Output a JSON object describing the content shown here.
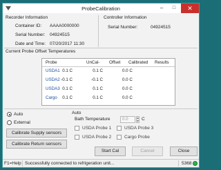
{
  "window": {
    "title": "ProbeCalibration"
  },
  "recorder": {
    "group_title": "Recorder Information",
    "container_label": "Container ID:",
    "container_value": "AAAA0000000",
    "serial_label": "Serial Number:",
    "serial_value": "04924515",
    "datetime_label": "Date and Time:",
    "datetime_value": "07/20/2017 11:30"
  },
  "controller": {
    "group_title": "Controller Information",
    "serial_label": "Serial Number:",
    "serial_value": "04924515"
  },
  "offsets": {
    "group_title": "Current Probe Offset Temperatures",
    "columns": [
      "Probe",
      "UnCal-",
      "Offset",
      "Calibrated",
      "Results"
    ],
    "rows": [
      {
        "probe": "USDA1",
        "uncal": "0.1 C",
        "offset": "0.1 C",
        "calibrated": "0.0 C",
        "result": ""
      },
      {
        "probe": "USDA2",
        "uncal": "-0.1 C",
        "offset": "-0.1 C",
        "calibrated": "0.0 C",
        "result": ""
      },
      {
        "probe": "USDA3",
        "uncal": "0.1 C",
        "offset": "0.1 C",
        "calibrated": "0.0 C",
        "result": ""
      },
      {
        "probe": "Cargo",
        "uncal": "0.1 C",
        "offset": "0.1 C",
        "calibrated": "0.0 C",
        "result": ""
      }
    ]
  },
  "mode": {
    "auto_label": "Auto",
    "external_label": "External",
    "selected": "Auto",
    "calibrate_supply": "Calibrate Supply sensors",
    "calibrate_return": "Calibrate Return sensors"
  },
  "auto_panel": {
    "title": "Auto",
    "bath_label": "Bath Temperature",
    "bath_value": "0.0",
    "bath_unit": "C",
    "probes": [
      {
        "label": "USDA Probe 1",
        "checked": false
      },
      {
        "label": "USDA Probe 3",
        "checked": false
      },
      {
        "label": "USDA Probe 2",
        "checked": false
      },
      {
        "label": "Cargo Probe",
        "checked": false
      }
    ]
  },
  "actions": {
    "start": "Start Cal",
    "cancel": "Cancel",
    "close": "Close"
  },
  "status": {
    "help": "F1=Help",
    "message": "Successfully connected to refrigeration unit...",
    "code": "5368",
    "indicator_color": "#2db34a"
  }
}
